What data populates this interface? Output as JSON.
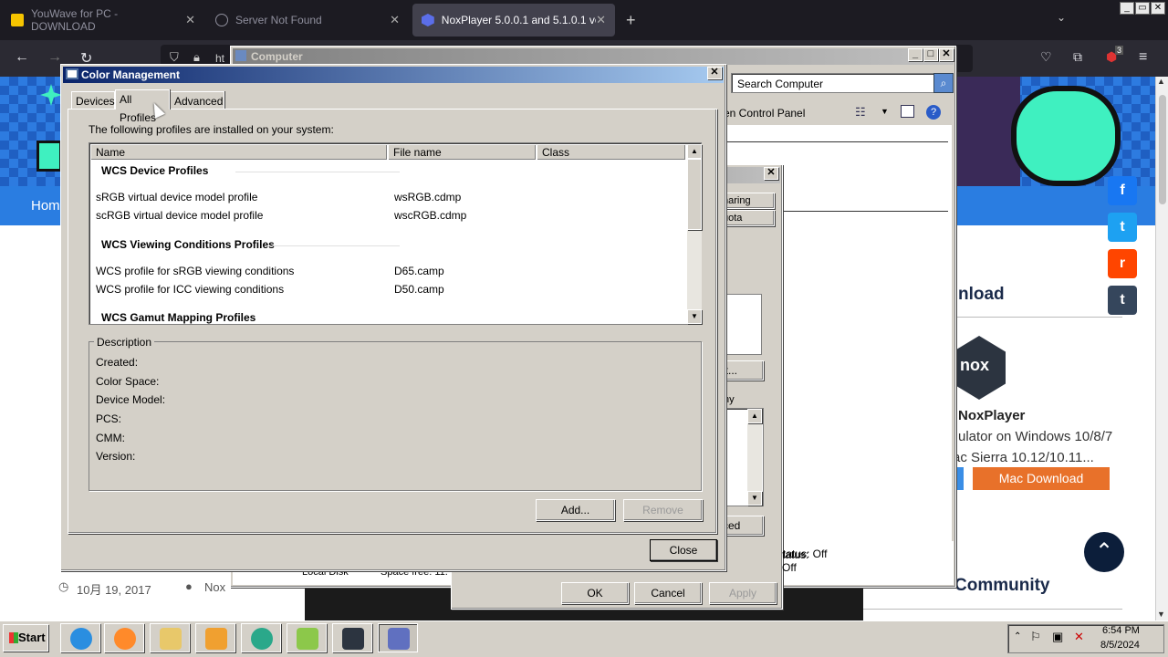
{
  "browser": {
    "tabs": [
      {
        "title": "YouWave for PC - DOWNLOAD"
      },
      {
        "title": "Server Not Found"
      },
      {
        "title": "NoxPlayer 5.0.0.1 and 5.1.0.1 ve"
      }
    ],
    "new_tab": "+",
    "tab_close": "✕",
    "tabs_list": "⌄",
    "back": "←",
    "forward": "→",
    "reload": "↻",
    "url_partial": "ht",
    "extension_badge": "3",
    "menu": "≡"
  },
  "site": {
    "home_link": "Hom",
    "download_title": "nload",
    "logo_text": "nox",
    "product_name": "NoxPlayer",
    "product_desc_1": "ulator on Windows 10/8/7",
    "product_desc_2": "ac Sierra 10.12/10.11...",
    "mac_download": "Mac Download",
    "community_title": "Community",
    "post_date": "10月 19, 2017",
    "post_author": "Nox",
    "back_to_top": "⌃",
    "share_facebook": "f",
    "share_twitter": "t",
    "share_reddit": "r",
    "share_tumblr": "t"
  },
  "computer_window": {
    "title": "Computer",
    "search_placeholder": "Search Computer",
    "toolbar_partial": "en Control Panel",
    "local_disk": "Local Disk",
    "space_free": "Space free: 11."
  },
  "properties_dialog": {
    "tab_sharing_partial": "haring",
    "tab_quota_partial": "uota",
    "edit_partial": "it...",
    "label_partial": "ny",
    "advanced_partial": "ced",
    "status_text": "tatus: Off",
    "ok": "OK",
    "cancel": "Cancel",
    "apply": "Apply"
  },
  "color_management": {
    "title": "Color Management",
    "tabs": [
      "Devices",
      "All Profiles",
      "Advanced"
    ],
    "intro": "The following profiles are installed on your system:",
    "columns": [
      "Name",
      "File name",
      "Class"
    ],
    "groups": [
      {
        "title": "WCS Device Profiles",
        "rows": [
          {
            "name": "sRGB virtual device model profile",
            "file": "wsRGB.cdmp"
          },
          {
            "name": "scRGB virtual device model profile",
            "file": "wscRGB.cdmp"
          }
        ]
      },
      {
        "title": "WCS Viewing Conditions Profiles",
        "rows": [
          {
            "name": "WCS profile for sRGB viewing conditions",
            "file": "D65.camp"
          },
          {
            "name": "WCS profile for ICC viewing conditions",
            "file": "D50.camp"
          }
        ]
      },
      {
        "title": "WCS Gamut Mapping Profiles",
        "rows": []
      }
    ],
    "description": {
      "legend": "Description",
      "labels": [
        "Created:",
        "Color Space:",
        "Device Model:",
        "PCS:",
        "CMM:",
        "Version:"
      ]
    },
    "add": "Add...",
    "remove": "Remove",
    "close": "Close"
  },
  "taskbar": {
    "start": "Start",
    "time": "6:54 PM",
    "date": "8/5/2024"
  },
  "colors": {
    "title_active": "#0a246a",
    "dialog_face": "#d4d0c8",
    "site_blue": "#1563c4",
    "mac_orange": "#e8712a"
  }
}
